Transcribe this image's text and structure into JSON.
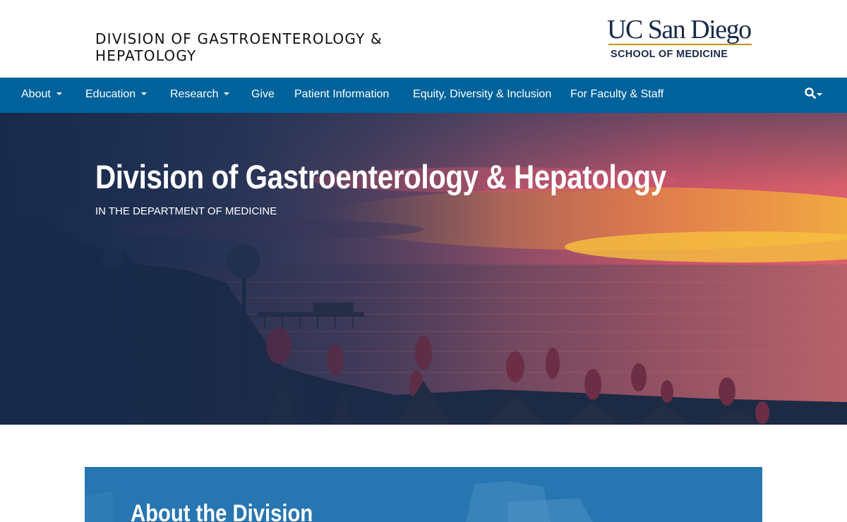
{
  "header": {
    "division_title": "DIVISION OF GASTROENTEROLOGY & HEPATOLOGY",
    "logo": {
      "wordmark": "UC San Diego",
      "school": "SCHOOL OF MEDICINE"
    }
  },
  "nav": {
    "items": [
      {
        "label": "About",
        "has_dropdown": true
      },
      {
        "label": "Education",
        "has_dropdown": true
      },
      {
        "label": "Research",
        "has_dropdown": true
      },
      {
        "label": "Give",
        "has_dropdown": false
      },
      {
        "label": "Patient Information",
        "has_dropdown": false
      },
      {
        "label": "Equity, Diversity & Inclusion",
        "has_dropdown": false
      },
      {
        "label": "For Faculty & Staff",
        "has_dropdown": false
      }
    ],
    "search_icon": "search-icon"
  },
  "hero": {
    "title": "Division of Gastroenterology & Hepatology",
    "subtitle": "IN THE DEPARTMENT OF MEDICINE"
  },
  "about": {
    "title": "About the Division"
  },
  "colors": {
    "nav_bg": "#00629b",
    "brand_navy": "#182b49",
    "brand_gold": "#c69214",
    "about_panel_bg": "#2775b1"
  }
}
